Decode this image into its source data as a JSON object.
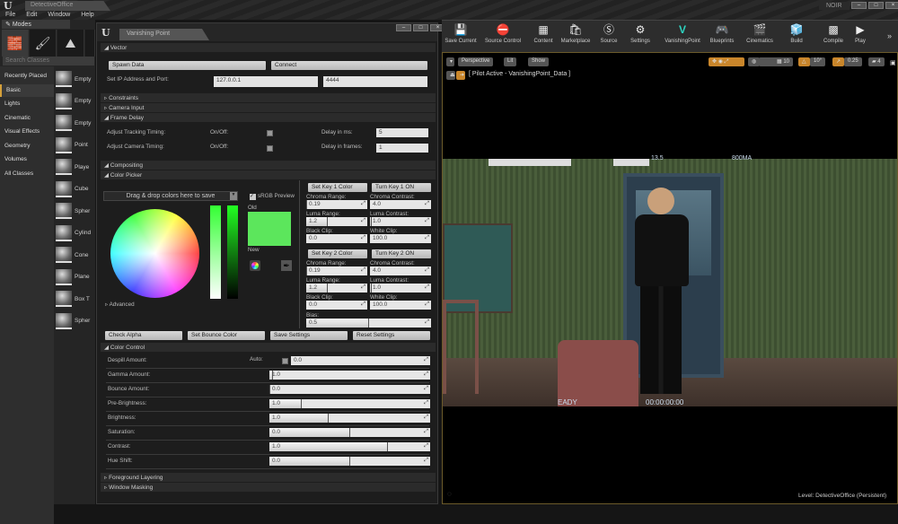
{
  "app": {
    "title": "DetectiveOffice",
    "menu": [
      "File",
      "Edit",
      "Window",
      "Help"
    ],
    "project": "NOIR"
  },
  "modes": {
    "tab": "Modes",
    "search_placeholder": "Search Classes",
    "categories": [
      "Recently Placed",
      "Basic",
      "Lights",
      "Cinematic",
      "Visual Effects",
      "Geometry",
      "Volumes",
      "All Classes"
    ],
    "selected": "Basic",
    "items": [
      "Empty",
      "Empty",
      "Empty",
      "Point",
      "Playe",
      "Cube",
      "Spher",
      "Cylind",
      "Cone",
      "Plane",
      "Box T",
      "Spher"
    ]
  },
  "panel": {
    "tab": "Vanishing Point",
    "vector": {
      "header": "Vector",
      "spawn": "Spawn Data",
      "connect": "Connect",
      "ip_label": "Set IP Address and Port:",
      "ip": "127.0.0.1",
      "port": "4444"
    },
    "constraints": "Constraints",
    "camera_input": "Camera Input",
    "frame_delay": {
      "header": "Frame Delay",
      "tracking": "Adjust Tracking Timing:",
      "camera": "Adjust Camera Timing:",
      "onoff": "On/Off:",
      "delay_ms_label": "Delay in ms:",
      "delay_ms": "5",
      "delay_frames_label": "Delay in frames:",
      "delay_frames": "1"
    },
    "compositing": "Compositing",
    "color_picker": {
      "header": "Color Picker",
      "swatch_placeholder": "Drag & drop colors here to save",
      "srgb": "sRGB Preview",
      "old": "Old",
      "new": "New",
      "advanced": "Advanced",
      "color": "#5ce65c"
    },
    "key1": {
      "set": "Set Key 1 Color",
      "turn": "Turn Key 1 ON",
      "chroma_range": "0.19",
      "chroma_contrast": "4.0",
      "luma_range": "1.2",
      "luma_contrast": "1.0",
      "black_clip": "0.0",
      "white_clip": "100.0"
    },
    "key2": {
      "set": "Set Key 2 Color",
      "turn": "Turn Key 2 ON",
      "chroma_range": "0.19",
      "chroma_contrast": "4.0",
      "luma_range": "1.2",
      "luma_contrast": "1.0",
      "black_clip": "0.0",
      "white_clip": "100.0",
      "bias": "0.5"
    },
    "key_labels": {
      "chroma_range": "Chroma Range:",
      "chroma_contrast": "Chroma Contrast:",
      "luma_range": "Luma Range:",
      "luma_contrast": "Luma Contrast:",
      "black_clip": "Black Clip:",
      "white_clip": "White Clip:",
      "bias": "Bias:"
    },
    "actions": [
      "Check Alpha",
      "Set Bounce Color",
      "Save Settings",
      "Reset Settings"
    ],
    "color_control": {
      "header": "Color Control",
      "auto": "Auto:",
      "rows": [
        {
          "label": "Despill Amount:",
          "value": "0.0",
          "fill": 0
        },
        {
          "label": "Gamma Amount:",
          "value": "1.0",
          "fill": 0.02
        },
        {
          "label": "Bounce Amount:",
          "value": "0.0",
          "fill": 0
        },
        {
          "label": "Pre-Brightness:",
          "value": "1.0",
          "fill": 0.2
        },
        {
          "label": "Brightness:",
          "value": "1.0",
          "fill": 0.37
        },
        {
          "label": "Saturation:",
          "value": "0.0",
          "fill": 0.5
        },
        {
          "label": "Contrast:",
          "value": "1.0",
          "fill": 0.74
        },
        {
          "label": "Hue Shift:",
          "value": "0.0",
          "fill": 0.5
        }
      ]
    },
    "foreground": "Foreground Layering",
    "window_masking": "Window Masking"
  },
  "toolbar": [
    "Save Current",
    "Source Control",
    "Content",
    "Marketplace",
    "Source",
    "Settings",
    "VanishingPoint",
    "Blueprints",
    "Cinematics",
    "Build",
    "Compile",
    "Play"
  ],
  "viewport": {
    "perspective": "Perspective",
    "lit": "Lit",
    "show": "Show",
    "grid": "10",
    "angle": "10°",
    "scale": "0.25",
    "cam_speed": "4",
    "pilot": "[ Pilot Active - VanishingPoint_Data ]",
    "overlay_left": "13.5",
    "overlay_right": "800MA",
    "status": "EADY",
    "timecode": "00:00:00:00",
    "level_label": "Level:",
    "level": "DetectiveOffice (Persistent)"
  }
}
